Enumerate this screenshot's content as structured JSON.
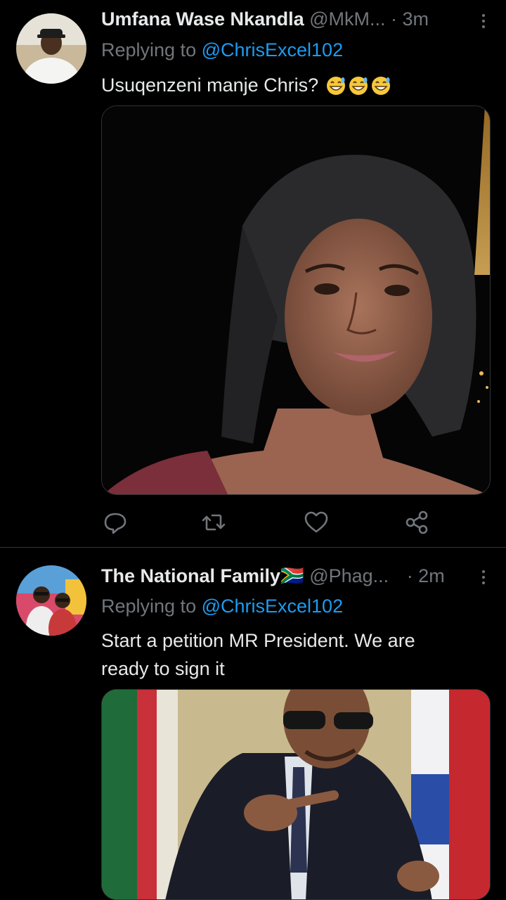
{
  "tweets": [
    {
      "name": "Umfana Wase Nkandla",
      "handle": "@MkM...",
      "time": "· 3m",
      "replying_prefix": "Replying to",
      "replying_to": "@ChrisExcel102",
      "text": "Usuqenzeni manje Chris?",
      "emoji": [
        "grinning-sweat-emoji",
        "grinning-sweat-emoji",
        "grinning-sweat-emoji"
      ]
    },
    {
      "name": "The National Family🇿🇦",
      "handle": "@Phag...",
      "time": "· 2m",
      "replying_prefix": "Replying to",
      "replying_to": "@ChrisExcel102",
      "text": "Start a petition MR President. We are ready to sign it"
    }
  ],
  "colors": {
    "background": "#000000",
    "text": "#e7e9ea",
    "secondary": "#71767b",
    "accent": "#1d9bf0",
    "divider": "#2f3336"
  },
  "icons": [
    "reply-icon",
    "retweet-icon",
    "like-icon",
    "share-icon",
    "more-icon"
  ]
}
